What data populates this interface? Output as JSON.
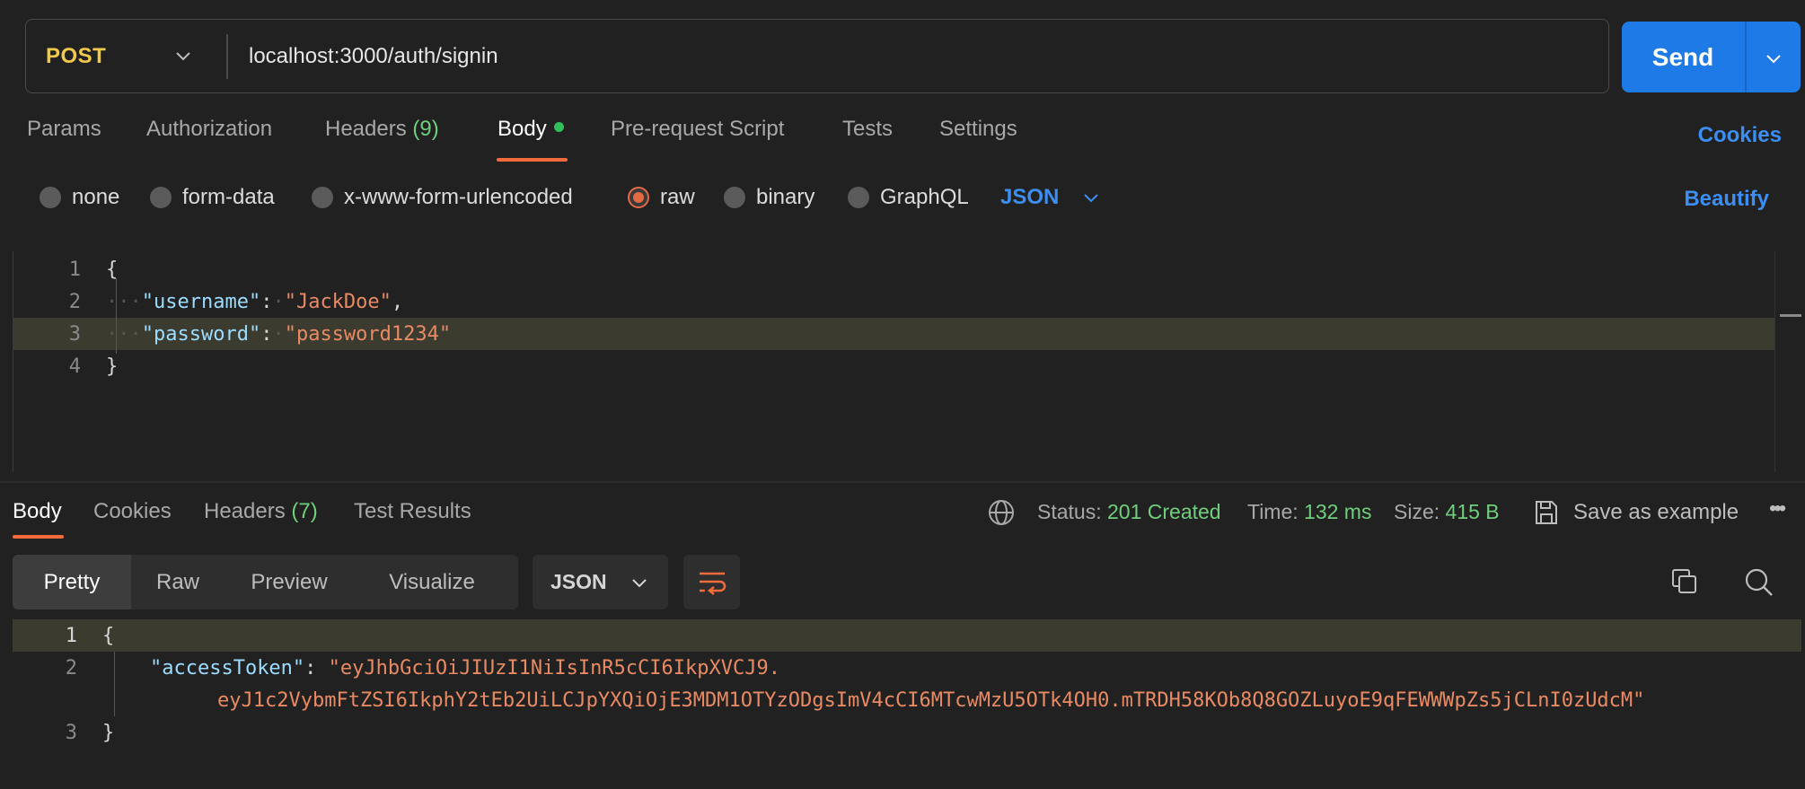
{
  "request": {
    "method": "POST",
    "url": "localhost:3000/auth/signin",
    "send_label": "Send"
  },
  "request_tabs": {
    "params": "Params",
    "authorization": "Authorization",
    "headers": "Headers",
    "headers_count": "(9)",
    "body": "Body",
    "pre_request": "Pre-request Script",
    "tests": "Tests",
    "settings": "Settings",
    "cookies": "Cookies"
  },
  "body_types": {
    "none": "none",
    "form_data": "form-data",
    "urlencoded": "x-www-form-urlencoded",
    "raw": "raw",
    "binary": "binary",
    "graphql": "GraphQL",
    "language": "JSON",
    "beautify": "Beautify",
    "selected": "raw"
  },
  "request_body": {
    "line_numbers": [
      "1",
      "2",
      "3",
      "4"
    ],
    "open_brace": "{",
    "close_brace": "}",
    "key1": "\"username\"",
    "val1": "\"JackDoe\"",
    "key2": "\"password\"",
    "val2": "\"password1234\""
  },
  "response_tabs": {
    "body": "Body",
    "cookies": "Cookies",
    "headers": "Headers",
    "headers_count": "(7)",
    "test_results": "Test Results"
  },
  "response_meta": {
    "status_label": "Status:",
    "status_value": "201 Created",
    "time_label": "Time:",
    "time_value": "132 ms",
    "size_label": "Size:",
    "size_value": "415 B",
    "save_example": "Save as example",
    "more": "•••"
  },
  "response_views": {
    "pretty": "Pretty",
    "raw": "Raw",
    "preview": "Preview",
    "visualize": "Visualize",
    "format": "JSON"
  },
  "response_body": {
    "line_numbers": [
      "1",
      "2",
      "3"
    ],
    "open_brace": "{",
    "close_brace": "}",
    "key": "\"accessToken\"",
    "token_part1": "\"eyJhbGciOiJIUzI1NiIsInR5cCI6IkpXVCJ9.",
    "token_part2": "eyJ1c2VybmFtZSI6IkphY2tEb2UiLCJpYXQiOjE3MDM1OTYzODgsImV4cCI6MTcwMzU5OTk4OH0.mTRDH58KOb8Q8GOZLuyoE9qFEWWWpZs5jCLnI0zUdcM\""
  },
  "colors": {
    "accent_orange": "#f26b3a",
    "send_blue": "#1d7ae6",
    "method_yellow": "#f0c94a",
    "status_green": "#6fcf7d"
  }
}
